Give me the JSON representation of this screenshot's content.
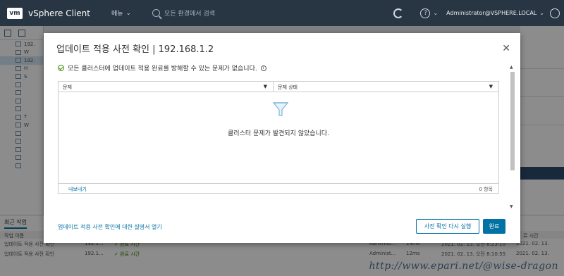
{
  "header": {
    "logo": "vm",
    "app_title": "vSphere Client",
    "menu_label": "메뉴",
    "search_placeholder": "모든 환경에서 검색",
    "user": "Administrator@VSPHERE.LOCAL"
  },
  "background": {
    "tree_items": [
      "192.",
      "W",
      "192.",
      "H",
      "S",
      "",
      "",
      "",
      "",
      "T",
      "W",
      "",
      "",
      "",
      "",
      ""
    ],
    "bottom_tab": "최근 작업",
    "bottom_columns": [
      "작업 이름"
    ],
    "bottom_end_column": "료 시간",
    "bottom_rows": [
      {
        "name": "업데이트 적용 사전 확인",
        "target": "192.1...",
        "status": "✓ 완료 시간",
        "user": "Administ...",
        "queued": "14ms",
        "start": "2021. 02. 13. 오전 8:23:10",
        "end": "2021. 02. 13."
      },
      {
        "name": "업데이트 적용 사전 확인",
        "target": "192.1...",
        "status": "✓ 완료 시간",
        "user": "Administ...",
        "queued": "12ms",
        "start": "2021. 02. 13. 오전 8:10:55",
        "end": "2021. 02. 13."
      }
    ]
  },
  "modal": {
    "title": "업데이트 적용 사전 확인 | 192.168.1.2",
    "status_message": "모든 클러스터에 업데이트 적용 완료를 방해할 수 있는 문제가 없습니다.",
    "columns": [
      "문제",
      "문제 상태"
    ],
    "empty_message": "클러스터 문제가 발견되지 않았습니다.",
    "export_label": "내보내기",
    "item_count": "0 항목",
    "help_link": "업데이트 적용 사전 확인에 대한 설명서 열기",
    "rerun_button": "사전 확인 다시 실행",
    "done_button": "완료"
  },
  "watermark": "http://www.epari.net/@wise-dragon",
  "colors": {
    "accent": "#0072a3",
    "header": "#283542",
    "success": "#3c8500"
  }
}
